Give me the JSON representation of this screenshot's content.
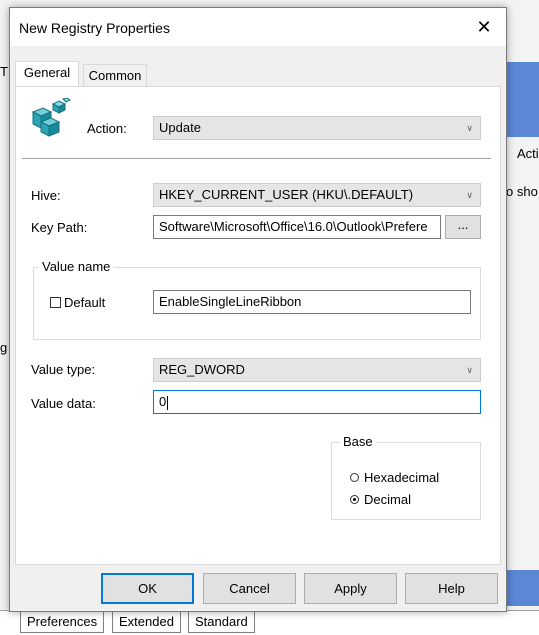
{
  "background": {
    "left_fragment": "T",
    "left_fragment_2": "g",
    "right_fragment_1": "Acti",
    "right_fragment_2": "o sho",
    "bottom_tabs": [
      "Preferences",
      "Extended",
      "Standard"
    ]
  },
  "dialog": {
    "title": "New Registry Properties",
    "close_glyph": "✕",
    "tabs": [
      "General",
      "Common"
    ]
  },
  "general": {
    "action_label": "Action:",
    "action_value": "Update",
    "hive_label": "Hive:",
    "hive_value": "HKEY_CURRENT_USER (HKU\\.DEFAULT)",
    "key_path_label": "Key Path:",
    "key_path_value": "Software\\Microsoft\\Office\\16.0\\Outlook\\Prefere",
    "browse_label": "...",
    "value_name_group": "Value name",
    "default_label": "Default",
    "value_name_value": "EnableSingleLineRibbon",
    "value_type_label": "Value type:",
    "value_type_value": "REG_DWORD",
    "value_data_label": "Value data:",
    "value_data_value": "0",
    "base_group": "Base",
    "base_options": [
      "Hexadecimal",
      "Decimal"
    ],
    "base_selected": "Decimal"
  },
  "buttons": {
    "ok": "OK",
    "cancel": "Cancel",
    "apply": "Apply",
    "help": "Help"
  },
  "colors": {
    "accent": "#0078d7",
    "background_blue": "#5b87d6",
    "dialog_bg": "#f0f0f0"
  },
  "icons": {
    "registry": "registry-editor-icon",
    "chevron": "chevron-down-icon",
    "close": "close-icon"
  }
}
